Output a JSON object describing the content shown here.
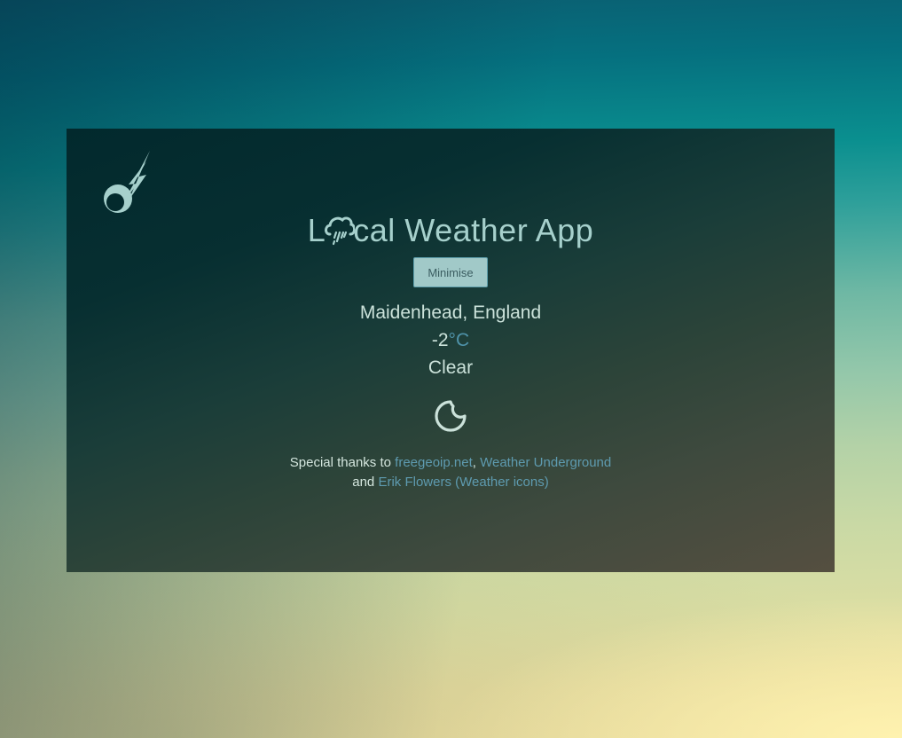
{
  "app": {
    "title_prefix": "L",
    "title_suffix": "cal Weather App",
    "minimise_label": "Minimise"
  },
  "weather": {
    "location": "Maidenhead, England",
    "temperature": "-2",
    "unit": "°C",
    "condition": "Clear",
    "icon": "night-clear-moon-icon"
  },
  "credits": {
    "prefix": "Special thanks to",
    "link1": "freegeoip.net",
    "sep": ",",
    "link2": "Weather Underground",
    "and": "and",
    "link3": "Erik Flowers (Weather icons)"
  },
  "colors": {
    "accent": "#a6d0cc",
    "link": "#5e9bb0",
    "unit": "#4f93aa",
    "button_bg": "#a1c9c8"
  },
  "icons": {
    "logo": "comet-icon",
    "title_o": "rain-cloud-icon"
  }
}
